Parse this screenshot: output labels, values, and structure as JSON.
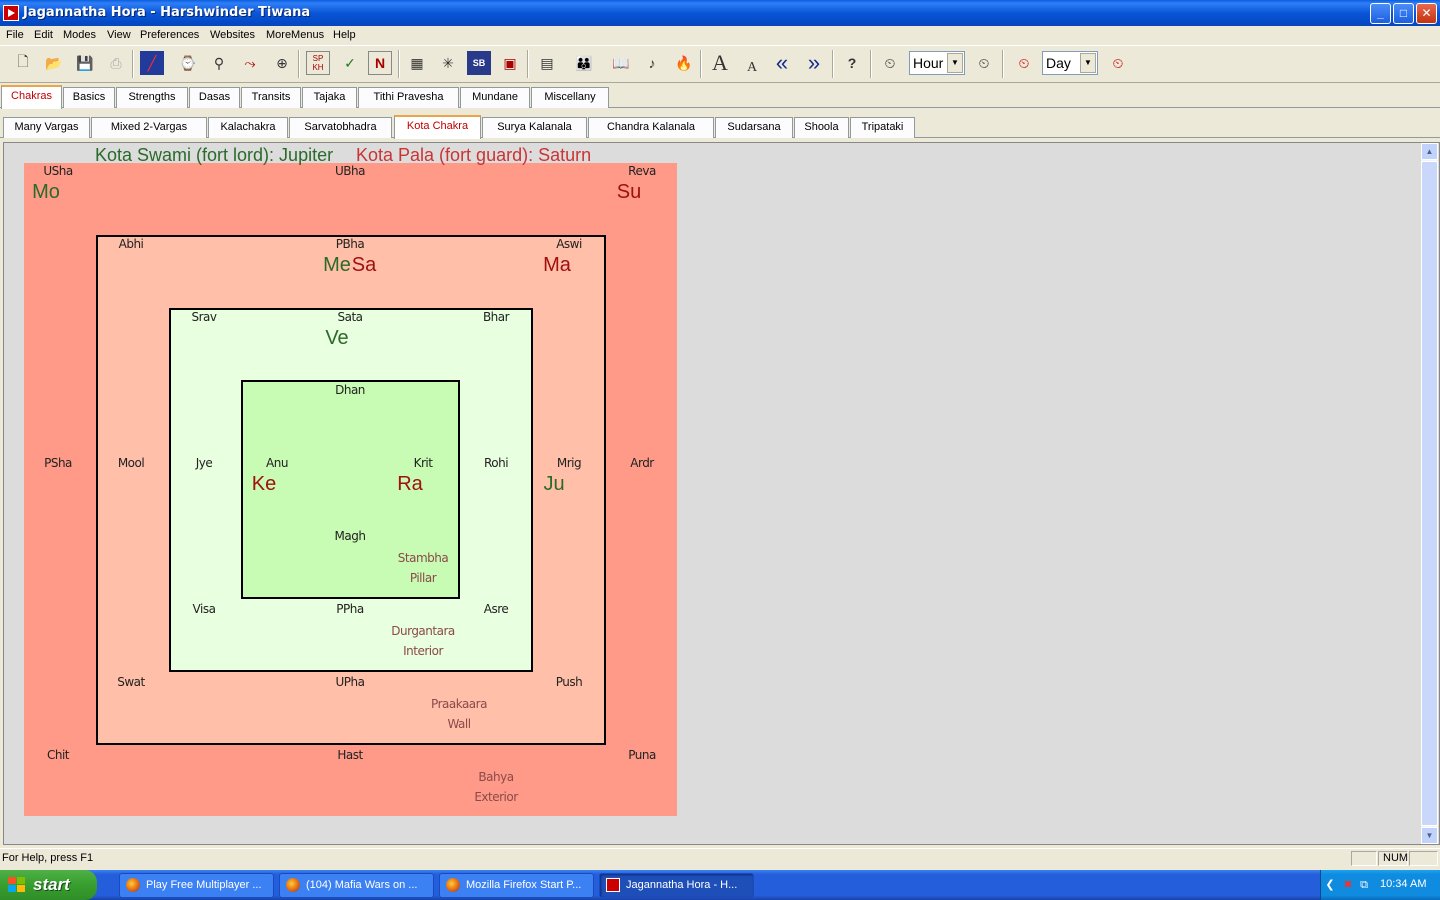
{
  "window": {
    "title": "Jagannatha Hora - Harshwinder Tiwana",
    "controls": {
      "minimize": "_",
      "maximize": "□",
      "close": "✕"
    }
  },
  "menu": [
    "File",
    "Edit",
    "Modes",
    "View",
    "Preferences",
    "Websites",
    "MoreMenus",
    "Help"
  ],
  "toolbar": {
    "hour_select": "Hour",
    "day_select": "Day",
    "icons": [
      "new-icon",
      "open-icon",
      "save-icon",
      "print-icon",
      "chart-icon",
      "data-icon",
      "transit-icon",
      "fork-icon",
      "compass-icon",
      "spkh-icon",
      "k-icon",
      "n-icon",
      "grid-icon",
      "sun-icon",
      "sb-icon",
      "kt-icon",
      "calendar-icon",
      "people-icon",
      "book-icon",
      "music-icon",
      "fire-icon",
      "font-larger-icon",
      "font-smaller-icon",
      "back-icon",
      "forward-icon",
      "help-icon",
      "hour-back-icon",
      "hour-forward-icon",
      "day-back-icon",
      "day-forward-icon"
    ],
    "labels": {
      "spkh": "SP KH",
      "n": "N",
      "sb": "SB",
      "font_large": "A",
      "font_small": "A",
      "help": "?",
      "back": "«",
      "forward": "»"
    }
  },
  "tabs_main": [
    "Chakras",
    "Basics",
    "Strengths",
    "Dasas",
    "Transits",
    "Tajaka",
    "Tithi Pravesha",
    "Mundane",
    "Miscellany"
  ],
  "tabs_main_active": "Chakras",
  "tabs_sub": [
    "Many Vargas",
    "Mixed 2-Vargas",
    "Kalachakra",
    "Sarvatobhadra",
    "Kota Chakra",
    "Surya Kalanala",
    "Chandra Kalanala",
    "Sudarsana",
    "Shoola",
    "Tripataki"
  ],
  "tabs_sub_active": "Kota Chakra",
  "kota": {
    "swami": "Kota Swami (fort lord): Jupiter",
    "pala": "Kota Pala (fort guard): Saturn",
    "nakshatras": {
      "usha": "USha",
      "ubha": "UBha",
      "reva": "Reva",
      "abhi": "Abhi",
      "pbha": "PBha",
      "aswi": "Aswi",
      "srav": "Srav",
      "sata": "Sata",
      "bhar": "Bhar",
      "dhan": "Dhan",
      "psha": "PSha",
      "mool": "Mool",
      "jye": "Jye",
      "anu": "Anu",
      "krit": "Krit",
      "rohi": "Rohi",
      "mrig": "Mrig",
      "ardr": "Ardr",
      "magh": "Magh",
      "visa": "Visa",
      "ppha": "PPha",
      "asre": "Asre",
      "swat": "Swat",
      "upha": "UPha",
      "push": "Push",
      "chit": "Chit",
      "hast": "Hast",
      "puna": "Puna"
    },
    "planets": {
      "mo": "Mo",
      "su": "Su",
      "me": "Me",
      "sa": "Sa",
      "ma": "Ma",
      "ve": "Ve",
      "ke": "Ke",
      "ra": "Ra",
      "ju": "Ju"
    },
    "zones": {
      "stambha": "Stambha",
      "stambha2": "Pillar",
      "durgantara": "Durgantara",
      "durgantara2": "Interior",
      "praakaara": "Praakaara",
      "praakaara2": "Wall",
      "bahya": "Bahya",
      "bahya2": "Exterior"
    }
  },
  "status": {
    "help": "For Help, press F1",
    "num": "NUM"
  },
  "taskbar": {
    "start": "start",
    "tasks": [
      "Play Free Multiplayer ...",
      "(104) Mafia Wars on ...",
      "Mozilla Firefox Start P...",
      "Jagannatha Hora - H..."
    ],
    "clock": "10:34 AM"
  },
  "colors": {
    "outer_zone": "#ff9a88",
    "wall_zone": "#ffbfa8",
    "interior_zone": "#e8ffe0",
    "pillar_zone": "#c8fcb4",
    "benefic": "#2a6a2a",
    "malefic": "#a01010",
    "guard": "#cc3333"
  }
}
